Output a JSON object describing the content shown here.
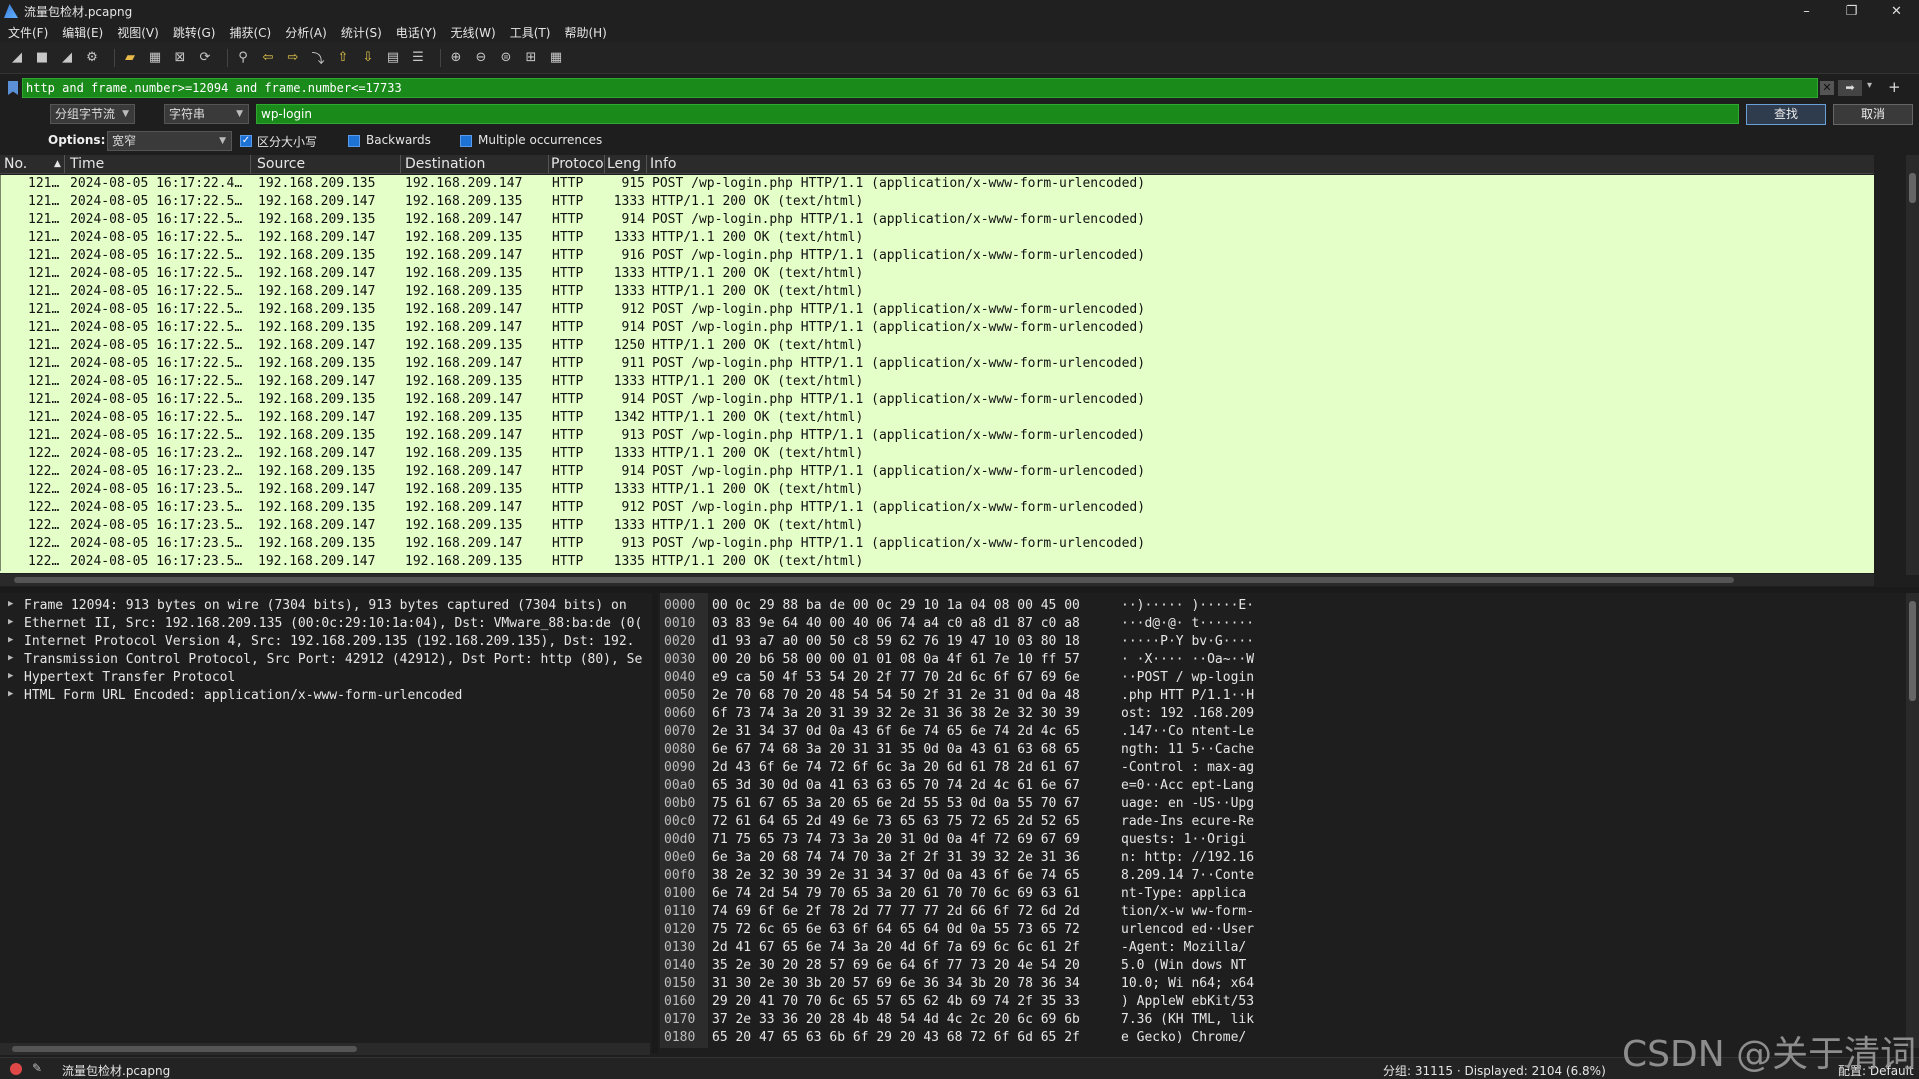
{
  "window": {
    "title": "流量包检材.pcapng",
    "controls": [
      "–",
      "❐",
      "✕"
    ]
  },
  "menu": [
    "文件(F)",
    "编辑(E)",
    "视图(V)",
    "跳转(G)",
    "捕获(C)",
    "分析(A)",
    "统计(S)",
    "电话(Y)",
    "无线(W)",
    "工具(T)",
    "帮助(H)"
  ],
  "toolbar_icons": [
    "shark-fin-icon",
    "stop-icon",
    "restart-icon",
    "options-icon",
    "open-icon",
    "save-icon",
    "close-file-icon",
    "reload-icon",
    "find-icon",
    "back-icon",
    "forward-icon",
    "go-to-packet-icon",
    "first-packet-icon",
    "last-packet-icon",
    "autoscroll-icon",
    "colorize-icon",
    "zoom-in-icon",
    "zoom-out-icon",
    "normal-size-icon",
    "resize-columns-icon",
    "layout-icon"
  ],
  "filter": {
    "value": "http and frame.number>=12094 and frame.number<=17733"
  },
  "find": {
    "search_in": "分组字节流",
    "search_type": "字符串",
    "value": "wp-login",
    "find_button": "查找",
    "cancel_button": "取消",
    "options_label": "Options:",
    "char_width": "宽窄",
    "case_sensitive_label": "区分大小写",
    "backwards_label": "Backwards",
    "multiple_label": "Multiple occurrences"
  },
  "columns": {
    "no": "No.",
    "time": "Time",
    "source": "Source",
    "destination": "Destination",
    "protocol": "Protoco",
    "length": "Leng",
    "info": "Info"
  },
  "packets": [
    {
      "no": "121…",
      "time": "2024-08-05 16:17:22.4…",
      "src": "192.168.209.135",
      "dst": "192.168.209.147",
      "proto": "HTTP",
      "len": "915",
      "info": "POST /wp-login.php HTTP/1.1  (application/x-www-form-urlencoded)"
    },
    {
      "no": "121…",
      "time": "2024-08-05 16:17:22.5…",
      "src": "192.168.209.147",
      "dst": "192.168.209.135",
      "proto": "HTTP",
      "len": "1333",
      "info": "HTTP/1.1 200 OK  (text/html)"
    },
    {
      "no": "121…",
      "time": "2024-08-05 16:17:22.5…",
      "src": "192.168.209.135",
      "dst": "192.168.209.147",
      "proto": "HTTP",
      "len": "914",
      "info": "POST /wp-login.php HTTP/1.1  (application/x-www-form-urlencoded)"
    },
    {
      "no": "121…",
      "time": "2024-08-05 16:17:22.5…",
      "src": "192.168.209.147",
      "dst": "192.168.209.135",
      "proto": "HTTP",
      "len": "1333",
      "info": "HTTP/1.1 200 OK  (text/html)"
    },
    {
      "no": "121…",
      "time": "2024-08-05 16:17:22.5…",
      "src": "192.168.209.135",
      "dst": "192.168.209.147",
      "proto": "HTTP",
      "len": "916",
      "info": "POST /wp-login.php HTTP/1.1  (application/x-www-form-urlencoded)"
    },
    {
      "no": "121…",
      "time": "2024-08-05 16:17:22.5…",
      "src": "192.168.209.147",
      "dst": "192.168.209.135",
      "proto": "HTTP",
      "len": "1333",
      "info": "HTTP/1.1 200 OK  (text/html)"
    },
    {
      "no": "121…",
      "time": "2024-08-05 16:17:22.5…",
      "src": "192.168.209.147",
      "dst": "192.168.209.135",
      "proto": "HTTP",
      "len": "1333",
      "info": "HTTP/1.1 200 OK  (text/html)"
    },
    {
      "no": "121…",
      "time": "2024-08-05 16:17:22.5…",
      "src": "192.168.209.135",
      "dst": "192.168.209.147",
      "proto": "HTTP",
      "len": "912",
      "info": "POST /wp-login.php HTTP/1.1  (application/x-www-form-urlencoded)"
    },
    {
      "no": "121…",
      "time": "2024-08-05 16:17:22.5…",
      "src": "192.168.209.135",
      "dst": "192.168.209.147",
      "proto": "HTTP",
      "len": "914",
      "info": "POST /wp-login.php HTTP/1.1  (application/x-www-form-urlencoded)"
    },
    {
      "no": "121…",
      "time": "2024-08-05 16:17:22.5…",
      "src": "192.168.209.147",
      "dst": "192.168.209.135",
      "proto": "HTTP",
      "len": "1250",
      "info": "HTTP/1.1 200 OK  (text/html)"
    },
    {
      "no": "121…",
      "time": "2024-08-05 16:17:22.5…",
      "src": "192.168.209.135",
      "dst": "192.168.209.147",
      "proto": "HTTP",
      "len": "911",
      "info": "POST /wp-login.php HTTP/1.1  (application/x-www-form-urlencoded)"
    },
    {
      "no": "121…",
      "time": "2024-08-05 16:17:22.5…",
      "src": "192.168.209.147",
      "dst": "192.168.209.135",
      "proto": "HTTP",
      "len": "1333",
      "info": "HTTP/1.1 200 OK  (text/html)"
    },
    {
      "no": "121…",
      "time": "2024-08-05 16:17:22.5…",
      "src": "192.168.209.135",
      "dst": "192.168.209.147",
      "proto": "HTTP",
      "len": "914",
      "info": "POST /wp-login.php HTTP/1.1  (application/x-www-form-urlencoded)"
    },
    {
      "no": "121…",
      "time": "2024-08-05 16:17:22.5…",
      "src": "192.168.209.147",
      "dst": "192.168.209.135",
      "proto": "HTTP",
      "len": "1342",
      "info": "HTTP/1.1 200 OK  (text/html)"
    },
    {
      "no": "121…",
      "time": "2024-08-05 16:17:22.5…",
      "src": "192.168.209.135",
      "dst": "192.168.209.147",
      "proto": "HTTP",
      "len": "913",
      "info": "POST /wp-login.php HTTP/1.1  (application/x-www-form-urlencoded)"
    },
    {
      "no": "122…",
      "time": "2024-08-05 16:17:23.2…",
      "src": "192.168.209.147",
      "dst": "192.168.209.135",
      "proto": "HTTP",
      "len": "1333",
      "info": "HTTP/1.1 200 OK  (text/html)"
    },
    {
      "no": "122…",
      "time": "2024-08-05 16:17:23.2…",
      "src": "192.168.209.135",
      "dst": "192.168.209.147",
      "proto": "HTTP",
      "len": "914",
      "info": "POST /wp-login.php HTTP/1.1  (application/x-www-form-urlencoded)"
    },
    {
      "no": "122…",
      "time": "2024-08-05 16:17:23.5…",
      "src": "192.168.209.147",
      "dst": "192.168.209.135",
      "proto": "HTTP",
      "len": "1333",
      "info": "HTTP/1.1 200 OK  (text/html)"
    },
    {
      "no": "122…",
      "time": "2024-08-05 16:17:23.5…",
      "src": "192.168.209.135",
      "dst": "192.168.209.147",
      "proto": "HTTP",
      "len": "912",
      "info": "POST /wp-login.php HTTP/1.1  (application/x-www-form-urlencoded)"
    },
    {
      "no": "122…",
      "time": "2024-08-05 16:17:23.5…",
      "src": "192.168.209.147",
      "dst": "192.168.209.135",
      "proto": "HTTP",
      "len": "1333",
      "info": "HTTP/1.1 200 OK  (text/html)"
    },
    {
      "no": "122…",
      "time": "2024-08-05 16:17:23.5…",
      "src": "192.168.209.135",
      "dst": "192.168.209.147",
      "proto": "HTTP",
      "len": "913",
      "info": "POST /wp-login.php HTTP/1.1  (application/x-www-form-urlencoded)"
    },
    {
      "no": "122…",
      "time": "2024-08-05 16:17:23.5…",
      "src": "192.168.209.147",
      "dst": "192.168.209.135",
      "proto": "HTTP",
      "len": "1335",
      "info": "HTTP/1.1 200 OK  (text/html)"
    }
  ],
  "details": [
    "Frame 12094: 913 bytes on wire (7304 bits), 913 bytes captured (7304 bits) on",
    "Ethernet II, Src: 192.168.209.135 (00:0c:29:10:1a:04), Dst: VMware_88:ba:de (0(",
    "Internet Protocol Version 4, Src: 192.168.209.135 (192.168.209.135), Dst: 192.",
    "Transmission Control Protocol, Src Port: 42912 (42912), Dst Port: http (80), Se",
    "Hypertext Transfer Protocol",
    "HTML Form URL Encoded: application/x-www-form-urlencoded"
  ],
  "hex": [
    {
      "off": "0000",
      "bytes": "00 0c 29 88 ba de 00 0c  29 10 1a 04 08 00 45 00",
      "ascii": "··)·····  )·····E·"
    },
    {
      "off": "0010",
      "bytes": "03 83 9e 64 40 00 40 06  74 a4 c0 a8 d1 87 c0 a8",
      "ascii": "···d@·@·  t·······"
    },
    {
      "off": "0020",
      "bytes": "d1 93 a7 a0 00 50 c8 59  62 76 19 47 10 03 80 18",
      "ascii": "·····P·Y  bv·G····"
    },
    {
      "off": "0030",
      "bytes": "00 20 b6 58 00 00 01 01  08 0a 4f 61 7e 10 ff 57",
      "ascii": "· ·X····  ··Oa~··W"
    },
    {
      "off": "0040",
      "bytes": "e9 ca 50 4f 53 54 20 2f  77 70 2d 6c 6f 67 69 6e",
      "ascii": "··POST /  wp-login"
    },
    {
      "off": "0050",
      "bytes": "2e 70 68 70 20 48 54 54  50 2f 31 2e 31 0d 0a 48",
      "ascii": ".php HTT  P/1.1··H"
    },
    {
      "off": "0060",
      "bytes": "6f 73 74 3a 20 31 39 32  2e 31 36 38 2e 32 30 39",
      "ascii": "ost: 192  .168.209"
    },
    {
      "off": "0070",
      "bytes": "2e 31 34 37 0d 0a 43 6f  6e 74 65 6e 74 2d 4c 65",
      "ascii": ".147··Co  ntent-Le"
    },
    {
      "off": "0080",
      "bytes": "6e 67 74 68 3a 20 31 31  35 0d 0a 43 61 63 68 65",
      "ascii": "ngth: 11  5··Cache"
    },
    {
      "off": "0090",
      "bytes": "2d 43 6f 6e 74 72 6f 6c  3a 20 6d 61 78 2d 61 67",
      "ascii": "-Control  : max-ag"
    },
    {
      "off": "00a0",
      "bytes": "65 3d 30 0d 0a 41 63 63  65 70 74 2d 4c 61 6e 67",
      "ascii": "e=0··Acc  ept-Lang"
    },
    {
      "off": "00b0",
      "bytes": "75 61 67 65 3a 20 65 6e  2d 55 53 0d 0a 55 70 67",
      "ascii": "uage: en  -US··Upg"
    },
    {
      "off": "00c0",
      "bytes": "72 61 64 65 2d 49 6e 73  65 63 75 72 65 2d 52 65",
      "ascii": "rade-Ins  ecure-Re"
    },
    {
      "off": "00d0",
      "bytes": "71 75 65 73 74 73 3a 20  31 0d 0a 4f 72 69 67 69",
      "ascii": "quests:   1··Origi"
    },
    {
      "off": "00e0",
      "bytes": "6e 3a 20 68 74 74 70 3a  2f 2f 31 39 32 2e 31 36",
      "ascii": "n: http:  //192.16"
    },
    {
      "off": "00f0",
      "bytes": "38 2e 32 30 39 2e 31 34  37 0d 0a 43 6f 6e 74 65",
      "ascii": "8.209.14  7··Conte"
    },
    {
      "off": "0100",
      "bytes": "6e 74 2d 54 79 70 65 3a  20 61 70 70 6c 69 63 61",
      "ascii": "nt-Type:   applica"
    },
    {
      "off": "0110",
      "bytes": "74 69 6f 6e 2f 78 2d 77  77 77 2d 66 6f 72 6d 2d",
      "ascii": "tion/x-w  ww-form-"
    },
    {
      "off": "0120",
      "bytes": "75 72 6c 65 6e 63 6f 64  65 64 0d 0a 55 73 65 72",
      "ascii": "urlencod  ed··User"
    },
    {
      "off": "0130",
      "bytes": "2d 41 67 65 6e 74 3a 20  4d 6f 7a 69 6c 6c 61 2f",
      "ascii": "-Agent:   Mozilla/"
    },
    {
      "off": "0140",
      "bytes": "35 2e 30 20 28 57 69 6e  64 6f 77 73 20 4e 54 20",
      "ascii": "5.0 (Win  dows NT "
    },
    {
      "off": "0150",
      "bytes": "31 30 2e 30 3b 20 57 69  6e 36 34 3b 20 78 36 34",
      "ascii": "10.0; Wi  n64; x64"
    },
    {
      "off": "0160",
      "bytes": "29 20 41 70 70 6c 65 57  65 62 4b 69 74 2f 35 33",
      "ascii": ") AppleW  ebKit/53"
    },
    {
      "off": "0170",
      "bytes": "37 2e 33 36 20 28 4b 48  54 4d 4c 2c 20 6c 69 6b",
      "ascii": "7.36 (KH  TML, lik"
    },
    {
      "off": "0180",
      "bytes": "65 20 47 65 63 6b 6f 29  20 43 68 72 6f 6d 65 2f",
      "ascii": "e Gecko)   Chrome/"
    }
  ],
  "status": {
    "file": "流量包检材.pcapng",
    "stats": "分组: 31115 · Displayed: 2104 (6.8%)",
    "profile": "配置: Default"
  },
  "watermark": "CSDN @关于清词",
  "colors": {
    "filter_valid": "#1a8a1a",
    "packet_http_bg": "#e4ffc7",
    "accent": "#1e72d6"
  }
}
